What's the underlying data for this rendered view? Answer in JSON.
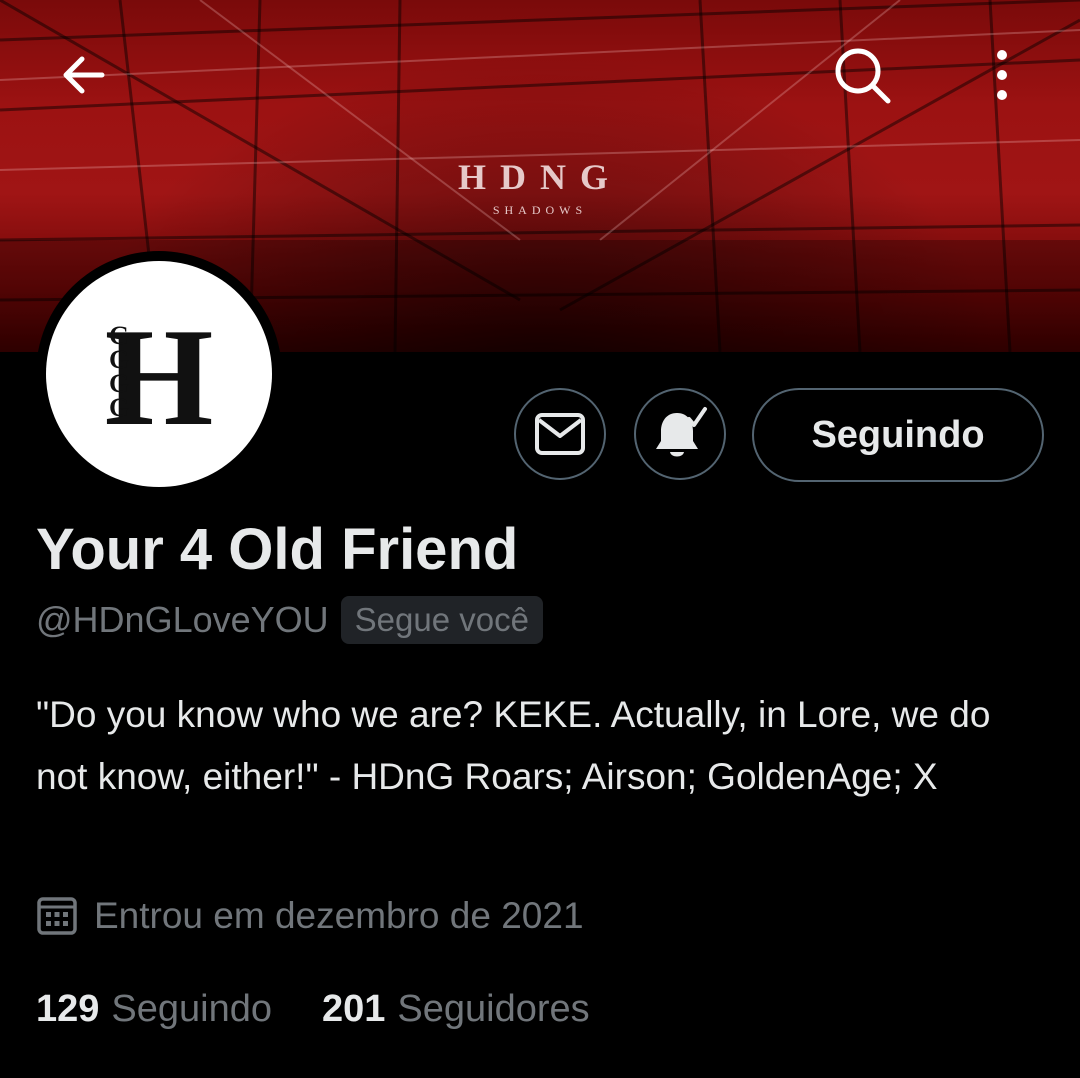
{
  "banner": {
    "brand_text": "HDNG",
    "brand_subtext": "SHADOWS",
    "tint_color": "#9c1212"
  },
  "top_bar": {
    "back_icon": "arrow-left-icon",
    "search_icon": "search-icon",
    "more_icon": "more-vertical-icon"
  },
  "avatar": {
    "letter": "H",
    "stack_letters": [
      "G",
      "G",
      "G",
      "G"
    ]
  },
  "actions": {
    "message_icon": "envelope-icon",
    "notify_icon": "bell-check-icon",
    "follow_label": "Seguindo"
  },
  "profile": {
    "display_name": "Your 4 Old Friend",
    "handle": "@HDnGLoveYOU",
    "follows_you": "Segue você",
    "bio": "\"Do you know who we are?  KEKE. Actually, in Lore, we do not know, either!\"  - HDnG Roars; Airson; GoldenAge; X",
    "joined": "Entrou em dezembro de 2021"
  },
  "stats": {
    "following_count": "129",
    "following_label": "Seguindo",
    "followers_count": "201",
    "followers_label": "Seguidores"
  },
  "colors": {
    "background": "#000000",
    "text_primary": "#e7e9ea",
    "text_secondary": "#71767b",
    "button_border": "#536471"
  }
}
